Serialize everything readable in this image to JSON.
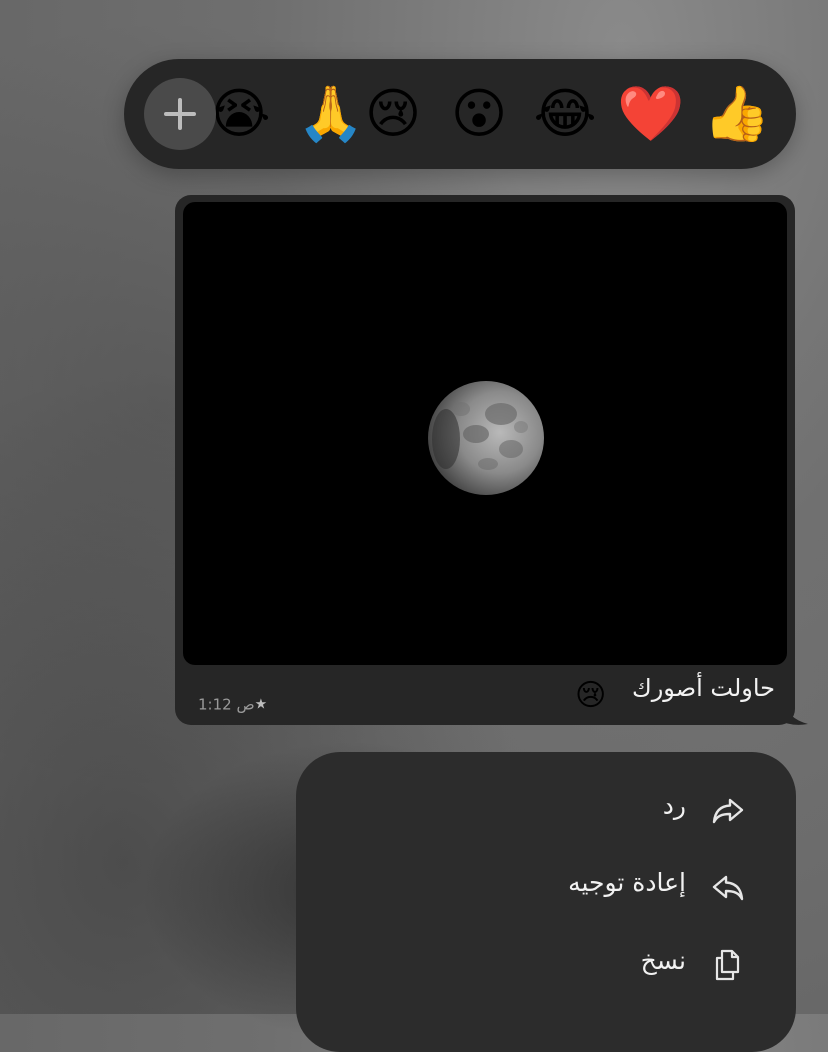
{
  "reactions": {
    "partial_emoji": "😭",
    "emojis": [
      "🙏",
      "😢",
      "😮",
      "😂",
      "❤️",
      "👍"
    ],
    "more_icon": "plus-icon"
  },
  "message": {
    "caption": "حاولت أصورك",
    "caption_emoji": "😢",
    "time": "1:12",
    "ampm": "ص",
    "starred": true,
    "star_glyph": "★",
    "photo_subject": "moon-photo"
  },
  "menu": {
    "items": [
      {
        "label": "رد",
        "icon": "reply-arrow-icon"
      },
      {
        "label": "إعادة توجيه",
        "icon": "forward-arrow-icon"
      },
      {
        "label": "نسخ",
        "icon": "copy-icon"
      }
    ]
  },
  "colors": {
    "bubble": "#262626",
    "menu": "#2c2c2c",
    "reaction_bar": "#262626",
    "text": "#f2f2f2",
    "meta_text": "#9a9a9a"
  }
}
